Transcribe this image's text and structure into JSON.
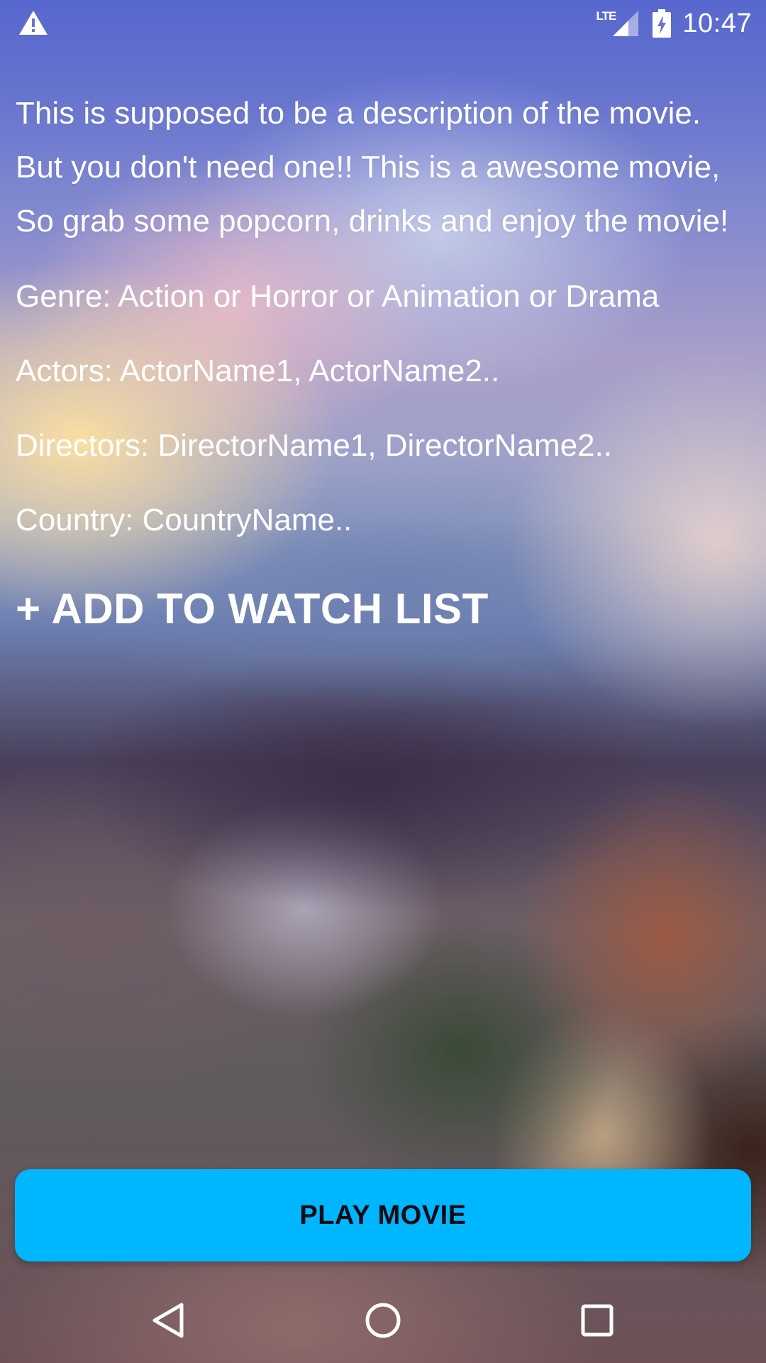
{
  "status_bar": {
    "network_label": "LTE",
    "time": "10:47",
    "icons": [
      "warning-icon",
      "signal-icon",
      "battery-charging-icon"
    ]
  },
  "movie": {
    "description": "This is supposed to be a description of the movie. But you don't need one!! This is a awesome movie, So grab some popcorn, drinks and enjoy the movie!",
    "genre": "Genre: Action or Horror or Animation or Drama",
    "actors": "Actors: ActorName1, ActorName2..",
    "directors": "Directors: DirectorName1, DirectorName2..",
    "country": "Country: CountryName.."
  },
  "actions": {
    "add_to_watch_list": "+ ADD TO WATCH LIST",
    "play_movie": "PLAY MOVIE"
  },
  "navigation": {
    "icons": [
      "back-icon",
      "home-icon",
      "recents-icon"
    ]
  },
  "colors": {
    "play_button": "#00b6ff",
    "play_button_text": "#0b0b14",
    "text": "#ffffff"
  }
}
